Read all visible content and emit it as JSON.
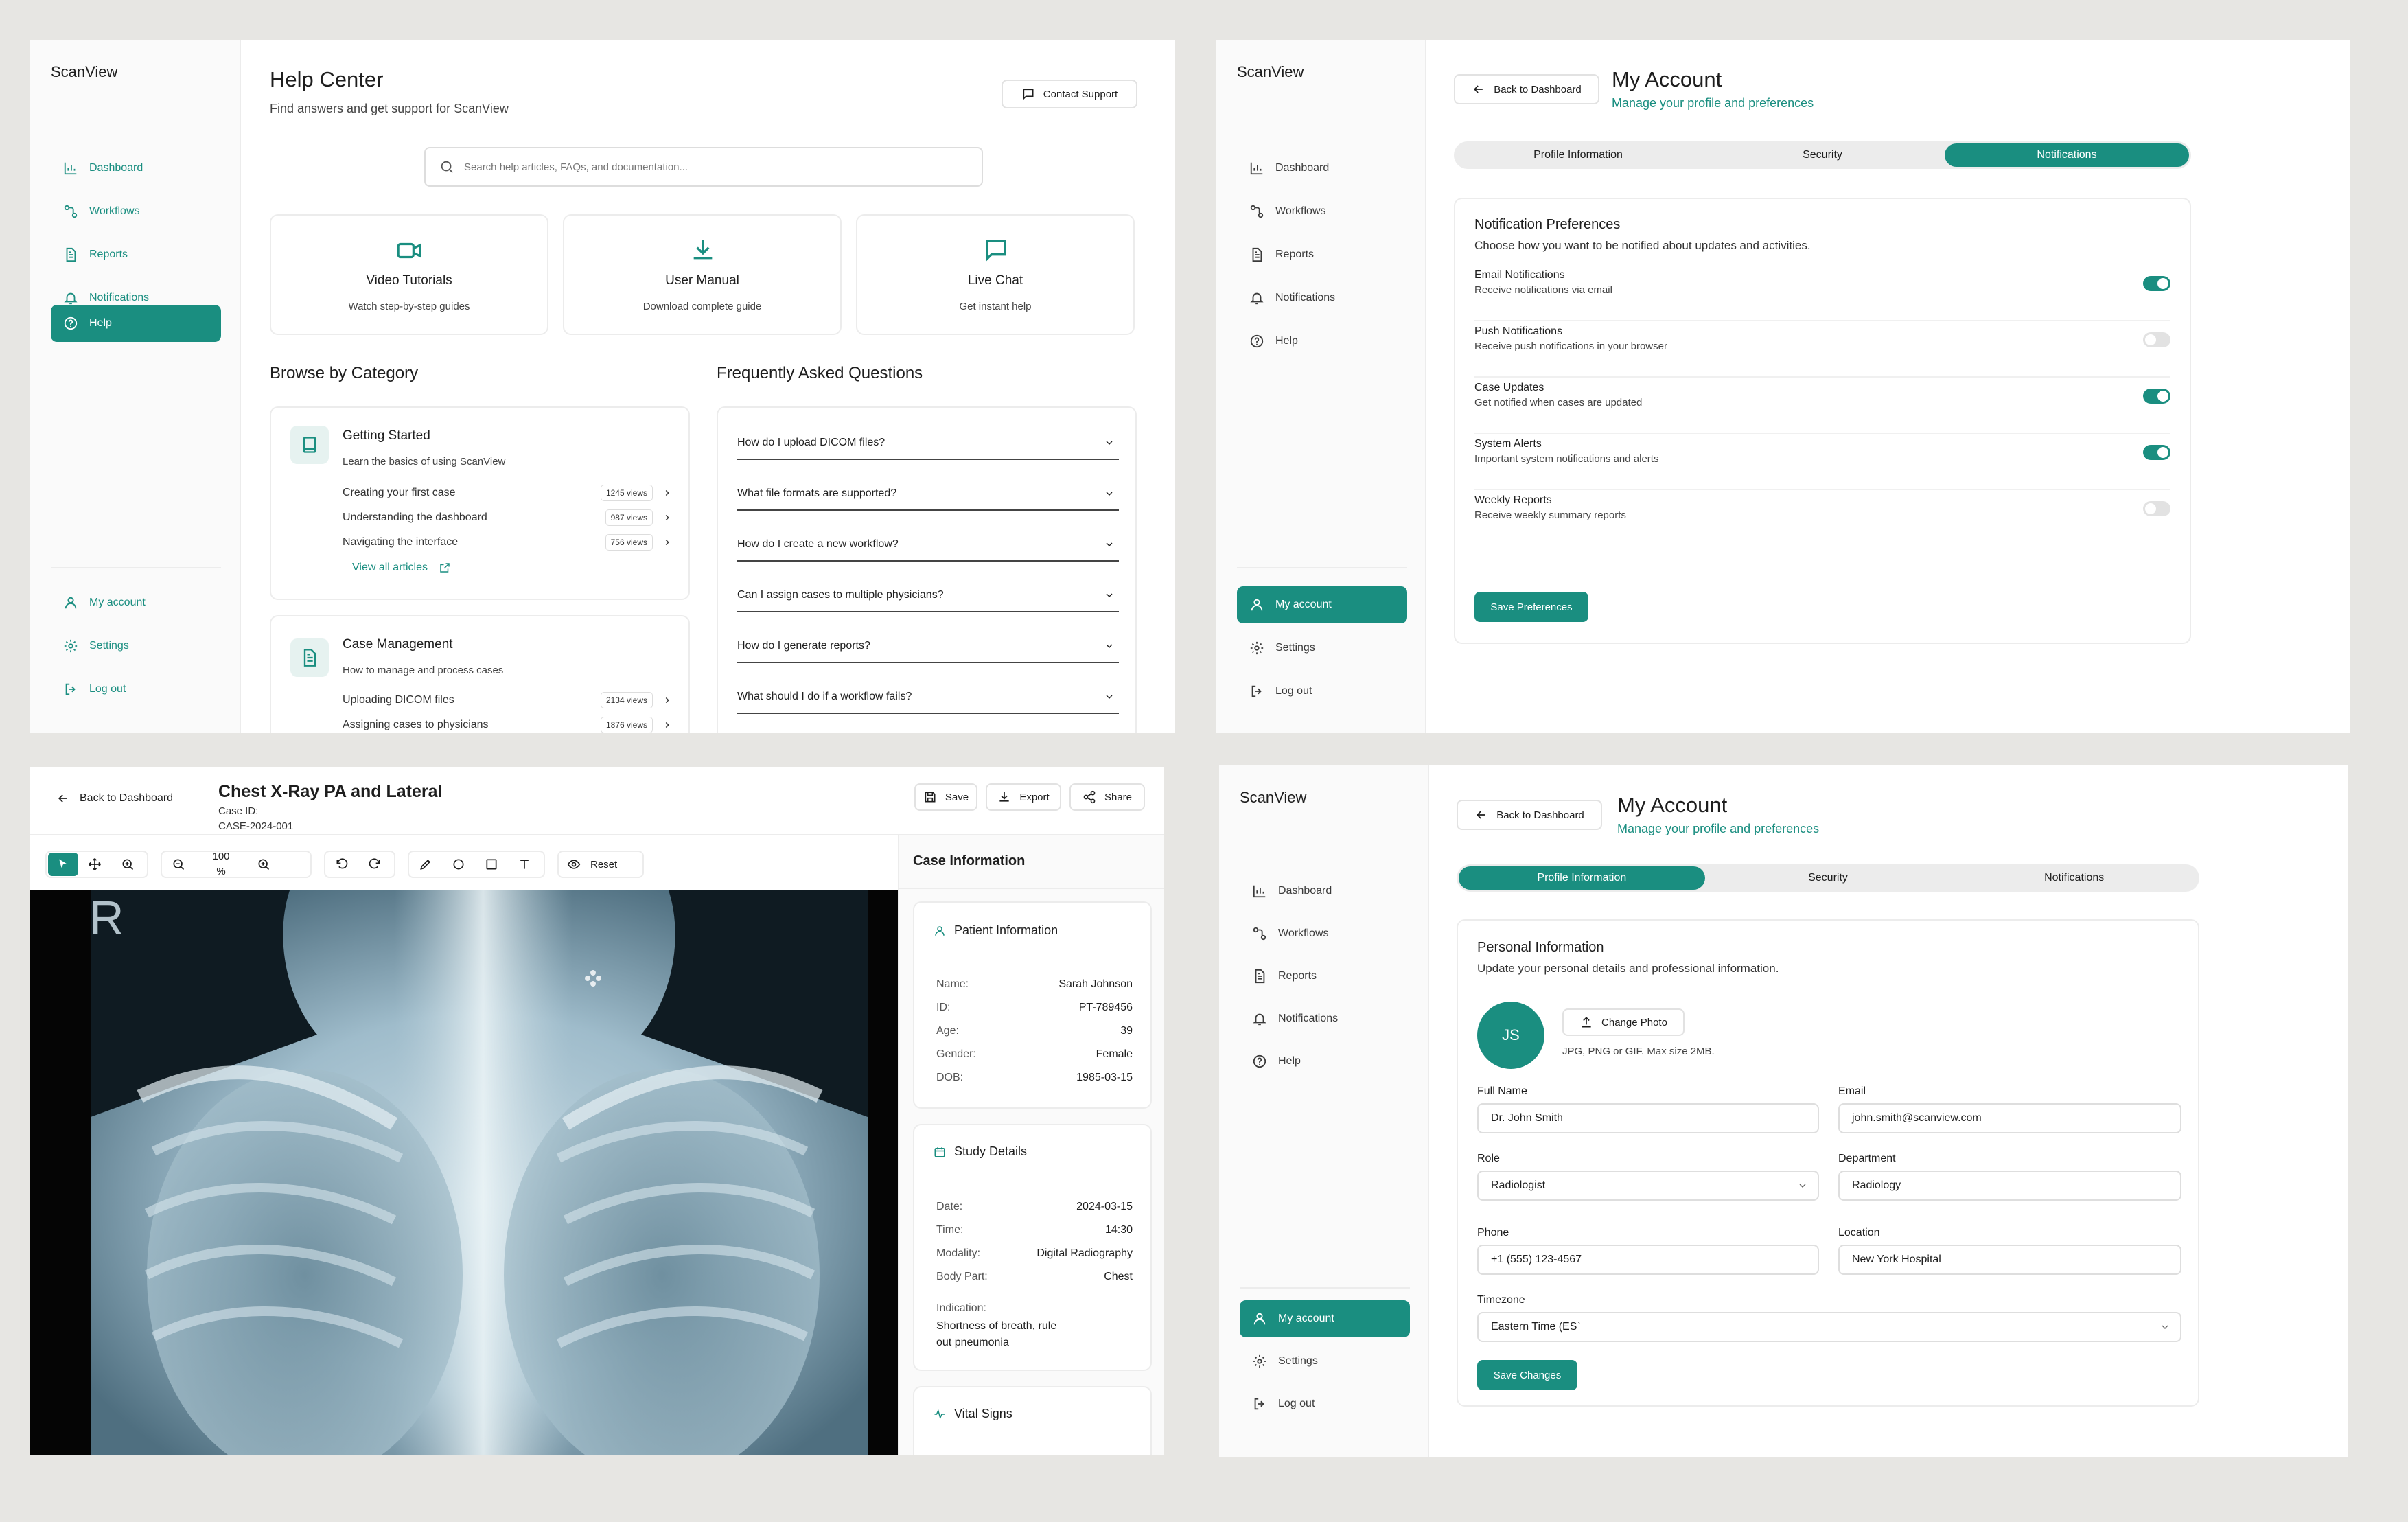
{
  "brand": "ScanView",
  "nav": {
    "dashboard": "Dashboard",
    "workflows": "Workflows",
    "reports": "Reports",
    "notifications": "Notifications",
    "help": "Help",
    "my_account": "My account",
    "settings": "Settings",
    "logout": "Log out"
  },
  "help_center": {
    "title": "Help Center",
    "subtitle": "Find answers and get support for ScanView",
    "contact": "Contact Support",
    "search_placeholder": "Search help articles, FAQs, and documentation...",
    "quick_cards": [
      {
        "title": "Video Tutorials",
        "desc": "Watch step-by-step guides"
      },
      {
        "title": "User Manual",
        "desc": "Download complete guide"
      },
      {
        "title": "Live Chat",
        "desc": "Get instant help"
      }
    ],
    "browse_title": "Browse by Category",
    "faq_title": "Frequently Asked Questions",
    "categories": [
      {
        "title": "Getting Started",
        "desc": "Learn the basics of using ScanView",
        "articles": [
          {
            "title": "Creating your first case",
            "views": "1245 views"
          },
          {
            "title": "Understanding the dashboard",
            "views": "987 views"
          },
          {
            "title": "Navigating the interface",
            "views": "756 views"
          }
        ],
        "view_all": "View all articles"
      },
      {
        "title": "Case Management",
        "desc": "How to manage and process cases",
        "articles": [
          {
            "title": "Uploading DICOM files",
            "views": "2134 views"
          },
          {
            "title": "Assigning cases to physicians",
            "views": "1876 views"
          }
        ]
      }
    ],
    "faqs": [
      "How do I upload DICOM files?",
      "What file formats are supported?",
      "How do I create a new workflow?",
      "Can I assign cases to multiple physicians?",
      "How do I generate reports?",
      "What should I do if a workflow fails?"
    ]
  },
  "account": {
    "back": "Back to Dashboard",
    "title": "My Account",
    "subtitle": "Manage your profile and preferences",
    "tabs": [
      "Profile Information",
      "Security",
      "Notifications"
    ]
  },
  "notifications_panel": {
    "title": "Notification Preferences",
    "desc": "Choose how you want to be notified about updates and activities.",
    "items": [
      {
        "title": "Email Notifications",
        "desc": "Receive notifications via email",
        "on": true
      },
      {
        "title": "Push Notifications",
        "desc": "Receive push notifications in your browser",
        "on": false
      },
      {
        "title": "Case Updates",
        "desc": "Get notified when cases are updated",
        "on": true
      },
      {
        "title": "System Alerts",
        "desc": "Important system notifications and alerts",
        "on": true
      },
      {
        "title": "Weekly Reports",
        "desc": "Receive weekly summary reports",
        "on": false
      }
    ],
    "save": "Save Preferences"
  },
  "viewer": {
    "back": "Back to Dashboard",
    "title": "Chest X-Ray PA and Lateral",
    "case_id_label": "Case ID:",
    "case_id": "CASE-2024-001",
    "save": "Save",
    "export": "Export",
    "share": "Share",
    "zoom": "100",
    "zoom_unit": "%",
    "reset": "Reset",
    "image_marker": "R",
    "info_title": "Case Information",
    "patient": {
      "title": "Patient Information",
      "rows": [
        {
          "k": "Name:",
          "v": "Sarah Johnson"
        },
        {
          "k": "ID:",
          "v": "PT-789456"
        },
        {
          "k": "Age:",
          "v": "39"
        },
        {
          "k": "Gender:",
          "v": "Female"
        },
        {
          "k": "DOB:",
          "v": "1985-03-15"
        }
      ]
    },
    "study": {
      "title": "Study Details",
      "rows": [
        {
          "k": "Date:",
          "v": "2024-03-15"
        },
        {
          "k": "Time:",
          "v": "14:30"
        },
        {
          "k": "Modality:",
          "v": "Digital Radiography"
        },
        {
          "k": "Body Part:",
          "v": "Chest"
        }
      ],
      "indication_label": "Indication:",
      "indication_line1": "Shortness of breath, rule",
      "indication_line2": "out pneumonia"
    },
    "vitals_title": "Vital Signs"
  },
  "profile": {
    "title": "Personal Information",
    "desc": "Update your personal details and professional information.",
    "initials": "JS",
    "change_photo": "Change Photo",
    "photo_hint": "JPG, PNG or GIF. Max size 2MB.",
    "full_name_label": "Full Name",
    "full_name": "Dr. John Smith",
    "email_label": "Email",
    "email": "john.smith@scanview.com",
    "role_label": "Role",
    "role": "Radiologist",
    "department_label": "Department",
    "department": "Radiology",
    "phone_label": "Phone",
    "phone": "+1 (555) 123-4567",
    "location_label": "Location",
    "location": "New York Hospital",
    "timezone_label": "Timezone",
    "timezone": "Eastern Time (ES`",
    "save": "Save Changes"
  },
  "colors": {
    "accent": "#1a8e80",
    "background": "#e7e6e3"
  }
}
